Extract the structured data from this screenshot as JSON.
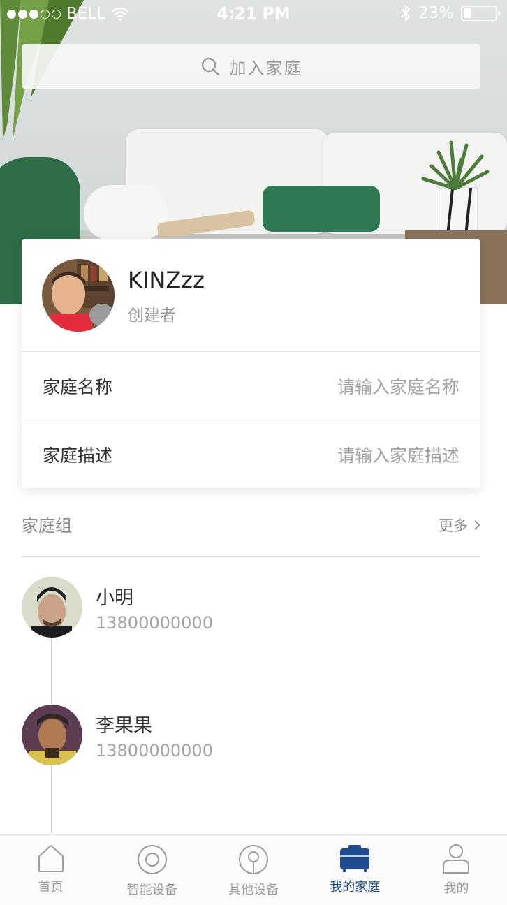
{
  "status_bar": {
    "carrier": "BELL",
    "signal_filled": 3,
    "signal_total": 5,
    "time": "4:21 PM",
    "battery_text": "23%",
    "battery_level": 0.23
  },
  "search": {
    "placeholder": "加入家庭",
    "icon": "search-icon"
  },
  "profile": {
    "name": "KINZzz",
    "role": "创建者"
  },
  "form": {
    "family_name_label": "家庭名称",
    "family_name_placeholder": "请输入家庭名称",
    "family_desc_label": "家庭描述",
    "family_desc_placeholder": "请输入家庭描述"
  },
  "group": {
    "title": "家庭组",
    "more": "更多",
    "members": [
      {
        "name": "小明",
        "phone": "13800000000"
      },
      {
        "name": "李果果",
        "phone": "13800000000"
      }
    ]
  },
  "tabs": [
    {
      "label": "首页",
      "icon": "home-icon"
    },
    {
      "label": "智能设备",
      "icon": "smart-device-icon"
    },
    {
      "label": "其他设备",
      "icon": "other-device-icon"
    },
    {
      "label": "我的家庭",
      "icon": "family-icon",
      "active": true
    },
    {
      "label": "我的",
      "icon": "user-icon"
    }
  ],
  "colors": {
    "accent": "#1f4d8f",
    "inactive": "#9b9b9b"
  }
}
